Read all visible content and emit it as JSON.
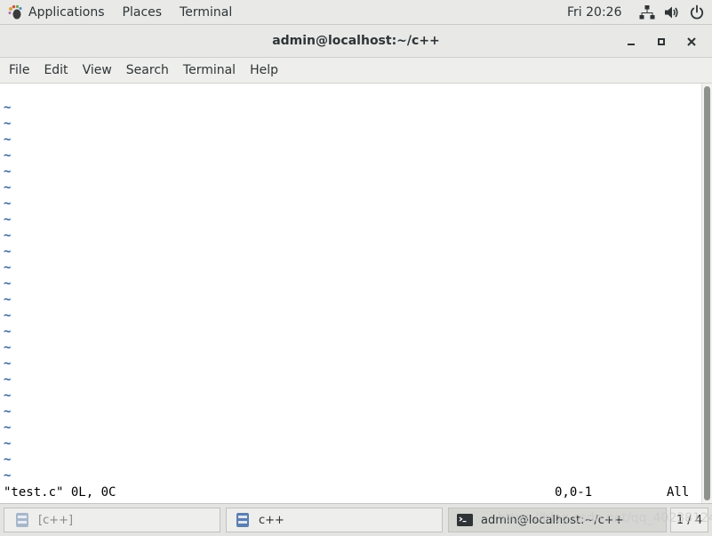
{
  "topbar": {
    "applications_label": "Applications",
    "places_label": "Places",
    "terminal_label": "Terminal",
    "clock": "Fri 20:26",
    "icons": [
      "gnome-foot-icon",
      "network-icon",
      "volume-icon",
      "power-icon"
    ]
  },
  "window": {
    "title": "admin@localhost:~/c++",
    "controls": [
      "minimize-icon",
      "maximize-icon",
      "close-icon"
    ]
  },
  "menubar": {
    "items": [
      "File",
      "Edit",
      "View",
      "Search",
      "Terminal",
      "Help"
    ]
  },
  "editor": {
    "empty_line_marker": "~",
    "empty_line_count": 24,
    "status": {
      "file_info": "\"test.c\" 0L, 0C",
      "cursor_position": "0,0-1",
      "scroll_position": "All"
    }
  },
  "taskbar": {
    "tasks": [
      {
        "label": "[c++]",
        "icon": "file-manager-icon",
        "active": false
      },
      {
        "label": "c++",
        "icon": "file-manager-icon",
        "active": false
      },
      {
        "label": "admin@localhost:~/c++",
        "icon": "terminal-icon",
        "active": true
      }
    ],
    "workspace_indicator": "1 / 4"
  },
  "watermark": "https://blog.csdn.net/qq_40238124",
  "colors": {
    "tilde": "#3465a4",
    "background": "#ffffff",
    "chrome": "#e9e9e8"
  }
}
